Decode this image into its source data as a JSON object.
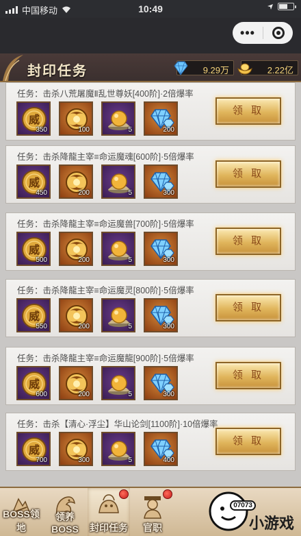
{
  "status": {
    "carrier": "中国移动",
    "time": "10:49"
  },
  "header": {
    "title": "封印任务",
    "diamonds": "9.29万",
    "gold": "2.22亿"
  },
  "claim_label": "领 取",
  "tasks": [
    {
      "text": "任务：击杀八荒屠魔Ⅱ乱世尊妖[400阶]·2倍爆率",
      "qty": [
        "350",
        "100",
        "5",
        "200"
      ]
    },
    {
      "text": "任务：击杀降龍主宰≡命运魔魂[600阶]·5倍爆率",
      "qty": [
        "450",
        "200",
        "5",
        "300"
      ]
    },
    {
      "text": "任务：击杀降龍主宰≡命运魔兽[700阶]·5倍爆率",
      "qty": [
        "500",
        "200",
        "5",
        "300"
      ]
    },
    {
      "text": "任务：击杀降龍主宰≡命运魔灵[800阶]·5倍爆率",
      "qty": [
        "550",
        "200",
        "5",
        "300"
      ]
    },
    {
      "text": "任务：击杀降龍主宰≡命运魔龍[900阶]·5倍爆率",
      "qty": [
        "600",
        "200",
        "5",
        "300"
      ]
    },
    {
      "text": "任务：击杀【清心·浮尘】华山论剑[1100阶]·10倍爆率",
      "qty": [
        "700",
        "300",
        "5",
        "400"
      ]
    }
  ],
  "nav": [
    {
      "label": "BOSS领地",
      "icon": "boss-territory-icon"
    },
    {
      "label": "领养BOSS",
      "icon": "dragon-icon"
    },
    {
      "label": "封印任务",
      "icon": "seal-icon"
    },
    {
      "label": "官职",
      "icon": "official-icon"
    }
  ],
  "watermark": {
    "brand": "07073",
    "text": "小游戏"
  }
}
